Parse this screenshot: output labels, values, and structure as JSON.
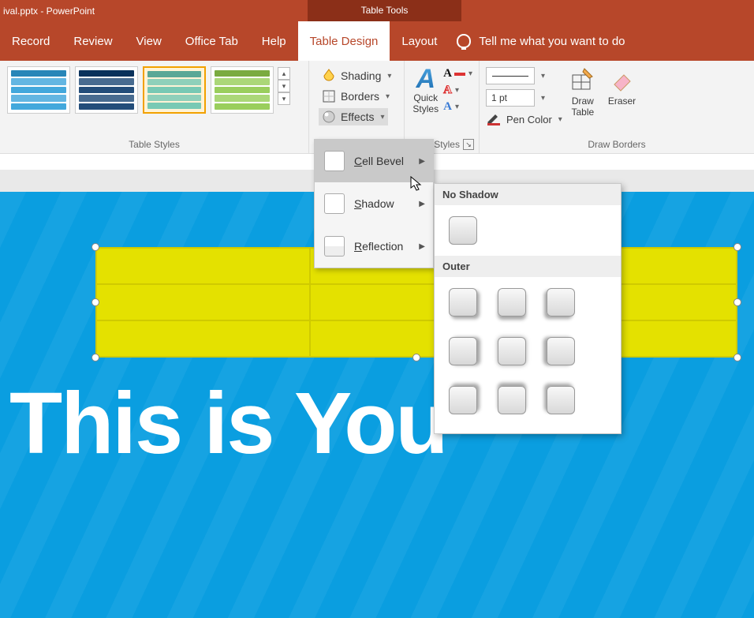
{
  "title": {
    "filename": "ival.pptx - PowerPoint",
    "contextual": "Table Tools"
  },
  "tabs": {
    "record": "Record",
    "review": "Review",
    "view": "View",
    "officetab": "Office Tab",
    "help": "Help",
    "tabledesign": "Table Design",
    "layout": "Layout",
    "tellme": "Tell me what you want to do"
  },
  "ribbon": {
    "table_styles_label": "Table Styles",
    "shading": "Shading",
    "borders": "Borders",
    "effects": "Effects",
    "quick_styles": "Quick\nStyles",
    "wordart_label": "Art Styles",
    "line_weight": "1 pt",
    "pen_color": "Pen Color",
    "draw_table": "Draw\nTable",
    "eraser": "Eraser",
    "draw_borders_label": "Draw Borders",
    "style_colors": [
      "#2f9ed8",
      "#0b3a6b",
      "#69c4b0",
      "#8fc94b"
    ]
  },
  "effects_menu": {
    "cell_bevel": "ell Bevel",
    "cell_bevel_pre": "C",
    "shadow": "hadow",
    "shadow_pre": "S",
    "reflection": "eflection",
    "reflection_pre": "R"
  },
  "shadow_gallery": {
    "no_shadow": "No Shadow",
    "outer": "Outer"
  },
  "slide": {
    "headline": "This is You"
  }
}
